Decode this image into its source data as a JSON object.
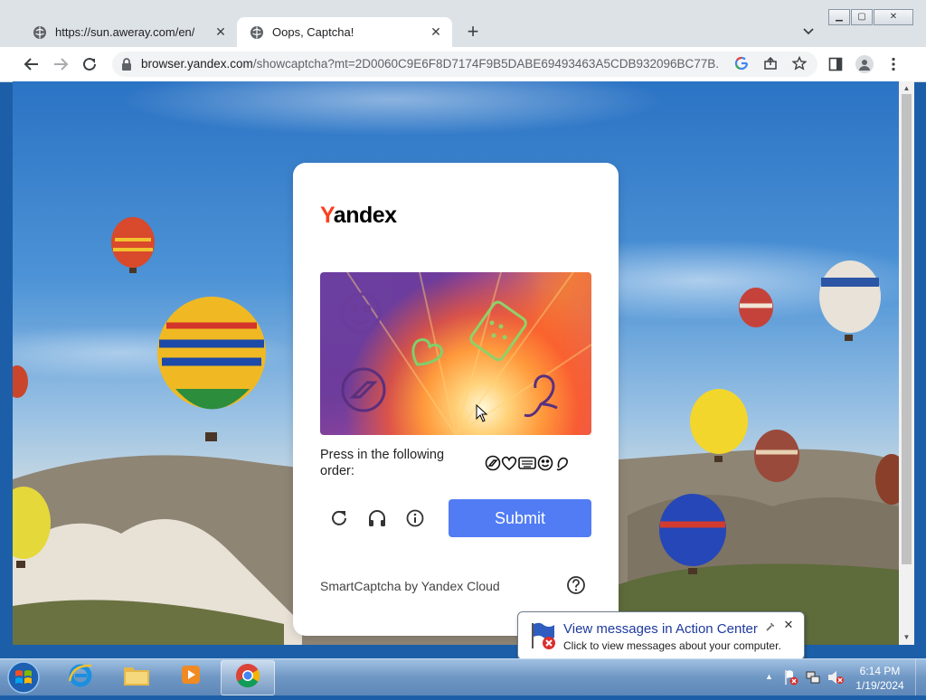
{
  "browser": {
    "tabs": [
      {
        "title": "https://sun.aweray.com/en/",
        "active": false
      },
      {
        "title": "Oops, Captcha!",
        "active": true
      }
    ],
    "url_host": "browser.yandex.com",
    "url_rest": "/showcaptcha?mt=2D0060C9E6F8D7174F9B5DABE69493463A5CDB932096BC77B..."
  },
  "captcha": {
    "logo_first": "Y",
    "logo_rest": "andex",
    "prompt": "Press in the following order:",
    "submit_label": "Submit",
    "footer": "SmartCaptcha by Yandex Cloud"
  },
  "notification": {
    "title": "View messages in Action Center",
    "body": "Click to view messages about your computer."
  },
  "clock": {
    "time": "6:14 PM",
    "date": "1/19/2024"
  }
}
